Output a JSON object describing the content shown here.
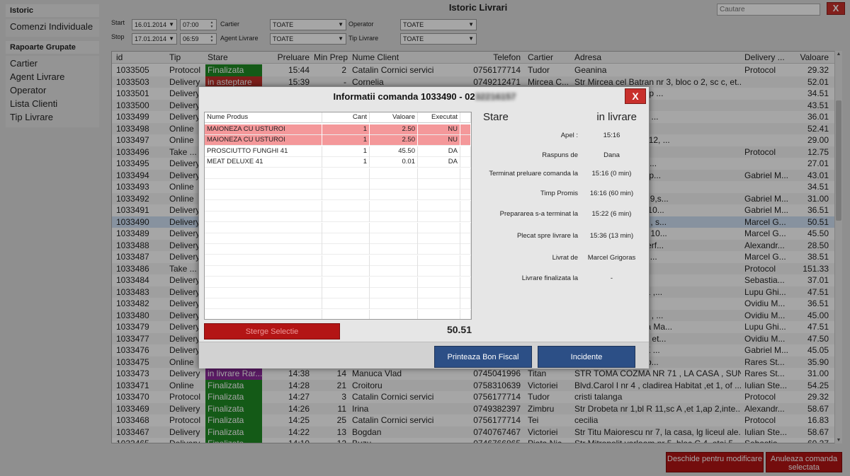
{
  "sidebar": {
    "head1": "Istoric",
    "group1": [
      "Comenzi Individuale"
    ],
    "head2": "Rapoarte Grupate",
    "group2": [
      "Cartier",
      "Agent Livrare",
      "Operator",
      "Lista Clienti",
      "Tip Livrare"
    ]
  },
  "header": {
    "title": "Istoric Livrari",
    "search_placeholder": "Cautare",
    "close": "X"
  },
  "filters": {
    "start_label": "Start",
    "stop_label": "Stop",
    "start_date": "16.01.2014",
    "start_time": "07:00",
    "stop_date": "17.01.2014",
    "stop_time": "06:59",
    "cartier_label": "Cartier",
    "cartier_value": "TOATE",
    "agent_label": "Agent Livrare",
    "agent_value": "TOATE",
    "operator_label": "Operator",
    "operator_value": "TOATE",
    "tip_label": "Tip Livrare",
    "tip_value": "TOATE"
  },
  "table": {
    "headers": [
      "id",
      "Tip",
      "Stare",
      "Preluare",
      "Min Prep",
      "Nume Client",
      "Telefon",
      "Cartier",
      "Adresa",
      "Delivery ...",
      "Valoare"
    ],
    "rows": [
      [
        "1033505",
        "Protocol",
        "Finalizata",
        "15:44",
        "2",
        "Catalin Cornici servici",
        "0756177714",
        "Tudor",
        "Geanina",
        "Protocol",
        "29.32"
      ],
      [
        "1033503",
        "Delivery",
        "in asteptare",
        "15:39",
        "-",
        "Cornelia",
        "0749212471",
        "Mircea C...",
        "Str Mircea cel Batran nr 3, bloc o 2, sc c, et...",
        "",
        "52.01"
      ],
      [
        "1033501",
        "Delivery",
        "",
        "",
        "",
        "",
        "",
        "",
        "Bl K 4, Sc A, Et 3, Ap ...",
        "",
        "34.51"
      ],
      [
        "1033500",
        "Delivery",
        "",
        "",
        "",
        "",
        "",
        "",
        "casa, sunati",
        "",
        "43.51"
      ],
      [
        "1033499",
        "Delivery",
        "",
        "",
        "",
        "",
        "",
        "",
        "-74 , bl P 3 , tr 2 , et ...",
        "",
        "36.01"
      ],
      [
        "1033498",
        "Online",
        "",
        "",
        "",
        "",
        "",
        "",
        "j 2 ,camera D207",
        "",
        "52.41"
      ],
      [
        "1033497",
        "Online",
        "",
        "",
        "",
        "",
        "",
        "",
        "Codrescu, Camin C12, ...",
        "",
        "29.00"
      ],
      [
        "1033496",
        "Take ...",
        "",
        "",
        "",
        "",
        "",
        "",
        "",
        "Protocol",
        "12.75"
      ],
      [
        "1033495",
        "Delivery",
        "",
        "",
        "",
        "",
        "",
        "",
        "10, tronson 1, etaj 4...",
        "",
        "27.01"
      ],
      [
        "1033494",
        "Delivery",
        "",
        "",
        "",
        "",
        "",
        "",
        "77 , sc D , parter , ap...",
        "Gabriel M...",
        "43.01"
      ],
      [
        "1033493",
        "Online",
        "",
        "",
        "",
        "",
        "",
        "",
        "casa, sunati",
        "",
        "34.51"
      ],
      [
        "1033492",
        "Online",
        "",
        "",
        "",
        "",
        "",
        "",
        "numarul 33, Bloc 919,s...",
        "Gabriel M...",
        "31.00"
      ],
      [
        "1033491",
        "Delivery",
        "",
        "",
        "",
        "",
        "",
        "",
        "bl 972 sc C et 2 ap 10...",
        "Gabriel M...",
        "36.51"
      ],
      [
        "1033490",
        "Delivery",
        "",
        "",
        "",
        "",
        "",
        "",
        "in curte la Embargo , s...",
        "Marcel G...",
        "50.51"
      ],
      [
        "1033489",
        "Delivery",
        "",
        "",
        "",
        "",
        "",
        "",
        "nr 50, bloc H 3, etaj 10...",
        "Marcel G...",
        "45.50"
      ],
      [
        "1033488",
        "Delivery",
        "",
        "",
        "",
        "",
        "",
        "",
        "bl 21, et 4,ap 15,interf...",
        "Alexandr...",
        "28.50"
      ],
      [
        "1033487",
        "Delivery",
        "",
        "",
        "",
        "",
        "",
        "",
        "2, bl B 1, sc A, et 2, ...",
        "Marcel G...",
        "38.51"
      ],
      [
        "1033486",
        "Take ...",
        "",
        "",
        "",
        "",
        "",
        "",
        "",
        "Protocol",
        "151.33"
      ],
      [
        "1033484",
        "Delivery",
        "",
        "",
        "",
        "",
        "",
        "",
        "taj 3, camera 33 B",
        "Sebastia...",
        "37.01"
      ],
      [
        "1033483",
        "Delivery",
        "",
        "",
        "",
        "",
        "",
        "",
        "B ,sc A , parter, ap 1 ,...",
        "Lupu Ghi...",
        "47.51"
      ],
      [
        "1033482",
        "Delivery",
        "",
        "",
        "",
        "",
        "",
        "",
        "jungeti",
        "Ovidiu M...",
        "36.51"
      ],
      [
        "1033480",
        "Delivery",
        "",
        "",
        "",
        "",
        "",
        "",
        "A !!!! la spitalul CFR , ...",
        "Ovidiu M...",
        "45.00"
      ],
      [
        "1033479",
        "Delivery",
        "",
        "",
        "",
        "",
        "",
        "",
        "Carrefour Felicia , la Ma...",
        "Lupu Ghi...",
        "47.51"
      ],
      [
        "1033477",
        "Delivery",
        "",
        "",
        "",
        "",
        "",
        "",
        "A !!!! Spital Parhon , et...",
        "Ovidiu M...",
        "47.50"
      ],
      [
        "1033476",
        "Delivery",
        "",
        "",
        "",
        "",
        "",
        "",
        "Sf Lazar nr 20 , Bl K ...",
        "Gabriel M...",
        "45.05"
      ],
      [
        "1033475",
        "Online",
        "",
        "",
        "",
        "",
        "",
        "",
        "bl.540 , parter , la lib...",
        "Rares St...",
        "35.90"
      ],
      [
        "1033473",
        "Delivery",
        "in livrare Rar...",
        "14:38",
        "14",
        "Manuca Vlad",
        "0745041996",
        "Titan",
        "STR TOMA COZMA NR 71 , LA CASA , SUN...",
        "Rares St...",
        "31.00"
      ],
      [
        "1033471",
        "Online",
        "Finalizata",
        "14:28",
        "21",
        "Croitoru",
        "0758310639",
        "Victoriei",
        "Blvd.Carol I nr 4 , cladirea Habitat ,et 1, of ...",
        "Iulian Ste...",
        "54.25"
      ],
      [
        "1033470",
        "Protocol",
        "Finalizata",
        "14:27",
        "3",
        "Catalin Cornici servici",
        "0756177714",
        "Tudor",
        "cristi talanga",
        "Protocol",
        "29.32"
      ],
      [
        "1033469",
        "Delivery",
        "Finalizata",
        "14:26",
        "11",
        "Irina",
        "0749382397",
        "Zimbru",
        "Str Drobeta nr 1,bl R 11,sc A ,et 1,ap 2,inte...",
        "Alexandr...",
        "58.67"
      ],
      [
        "1033468",
        "Protocol",
        "Finalizata",
        "14:25",
        "25",
        "Catalin Cornici servici",
        "0756177714",
        "Tei",
        "cecilia",
        "Protocol",
        "16.83"
      ],
      [
        "1033467",
        "Delivery",
        "Finalizata",
        "14:22",
        "13",
        "Bogdan",
        "0740767467",
        "Victoriei",
        "Str Titu Maiorescu nr 7, la casa, lg liceul ale...",
        "Iulian Ste...",
        "58.67"
      ],
      [
        "1033465",
        "Delivery",
        "Finalizata",
        "14:10",
        "12",
        "Buzu",
        "0746766865",
        "Piata Nic...",
        "Str Mitropolit varlaam nr 5, bloc C 4, etaj 5...",
        "Sebastia...",
        "60.37"
      ]
    ]
  },
  "bottom_buttons": {
    "modify": "Deschide pentru modificare",
    "cancel": "Anuleaza comanda selectata"
  },
  "modal": {
    "title": "Informatii comanda 1033490 - 02",
    "title_phone_hidden": "32216157",
    "close": "X",
    "product_headers": [
      "Nume Produs",
      "Cant",
      "Valoare",
      "Executat"
    ],
    "products": [
      [
        "MAIONEZA CU USTUROI",
        "1",
        "2.50",
        "NU"
      ],
      [
        "MAIONEZA CU USTUROI",
        "1",
        "2.50",
        "NU"
      ],
      [
        "PROSCIUTTO FUNGHI 41",
        "1",
        "45.50",
        "DA"
      ],
      [
        "MEAT DELUXE 41",
        "1",
        "0.01",
        "DA"
      ]
    ],
    "delete_button": "Sterge Selectie",
    "total": "50.51",
    "stare_label": "Stare",
    "stare_value": "in livrare",
    "info": [
      {
        "label": "Apel :",
        "value": "15:16"
      },
      {
        "label": "Raspuns de",
        "value": "Dana"
      },
      {
        "label": "Terminat preluare comanda la",
        "value": "15:16 (0 min)"
      },
      {
        "label": "Timp Promis",
        "value": "16:16 (60 min)"
      },
      {
        "label": "Prepararea s-a terminat la",
        "value": "15:22 (6 min)"
      },
      {
        "label": "Plecat spre livrare la",
        "value": "15:36 (13 min)"
      },
      {
        "label": "Livrat de",
        "value": "Marcel Grigoras"
      },
      {
        "label": "Livrare finalizata la",
        "value": "-"
      }
    ],
    "print_button": "Printeaza Bon Fiscal",
    "incidents_button": "Incidente"
  },
  "colors": {
    "finalizata": "#1f8a24",
    "asteptare": "#c0302a",
    "livrare": "#8a2a9a",
    "accent_blue": "#2c4f86",
    "danger_red": "#b31515"
  }
}
